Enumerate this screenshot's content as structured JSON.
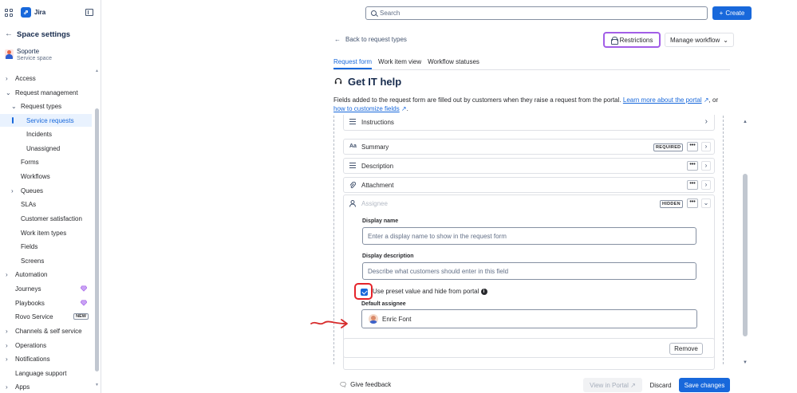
{
  "app": {
    "name": "Jira"
  },
  "sidebar": {
    "title": "Space settings",
    "space_name": "Soporte",
    "space_type": "Service space",
    "items": [
      {
        "label": "Access",
        "chevron": "›"
      },
      {
        "label": "Request management",
        "chevron": "⌄"
      },
      {
        "label": "Request types",
        "chevron": "⌄"
      },
      {
        "label": "Service requests",
        "active": true
      },
      {
        "label": "Incidents"
      },
      {
        "label": "Unassigned"
      },
      {
        "label": "Forms"
      },
      {
        "label": "Workflows"
      },
      {
        "label": "Queues",
        "chevron": "›"
      },
      {
        "label": "SLAs"
      },
      {
        "label": "Customer satisfaction"
      },
      {
        "label": "Work item types"
      },
      {
        "label": "Fields"
      },
      {
        "label": "Screens"
      },
      {
        "label": "Automation",
        "chevron": "›"
      },
      {
        "label": "Journeys",
        "icon": "premium-diamond-icon"
      },
      {
        "label": "Playbooks",
        "icon": "premium-diamond-icon"
      },
      {
        "label": "Rovo Service",
        "badge": "NEW"
      },
      {
        "label": "Channels & self service",
        "chevron": "›"
      },
      {
        "label": "Operations",
        "chevron": "›"
      },
      {
        "label": "Notifications",
        "chevron": "›"
      },
      {
        "label": "Language support"
      },
      {
        "label": "Apps",
        "chevron": "›"
      }
    ]
  },
  "topbar": {
    "search_placeholder": "Search",
    "create_label": "Create"
  },
  "header": {
    "back_label": "Back to request types",
    "restrictions_label": "Restrictions",
    "workflow_label": "Manage workflow"
  },
  "tabs": [
    "Request form",
    "Work item view",
    "Workflow statuses"
  ],
  "form": {
    "title": "Get IT help",
    "description_pre": "Fields added to the request form are filled out by customers when they raise a request from the portal.",
    "learn_more": "Learn more about the portal",
    "description_or": ", or",
    "customize_link": "how to customize fields",
    "fields": [
      {
        "label": "Instructions",
        "icon": "≡"
      },
      {
        "label": "Summary",
        "icon": "Aa",
        "badge": "REQUIRED"
      },
      {
        "label": "Description",
        "icon": "≡"
      },
      {
        "label": "Attachment",
        "icon": "⌀"
      }
    ],
    "assignee": {
      "label": "Assignee",
      "badge": "HIDDEN",
      "display_name_label": "Display name",
      "display_name_placeholder": "Enter a display name to show in the request form",
      "display_desc_label": "Display description",
      "display_desc_placeholder": "Describe what customers should enter in this field",
      "checkbox_label": "Use preset value and hide from portal",
      "checkbox_checked": true,
      "default_label": "Default assignee",
      "default_user": "Enric Font",
      "remove_label": "Remove"
    }
  },
  "footer": {
    "feedback_label": "Give feedback",
    "portal_label": "View in Portal",
    "discard_label": "Discard",
    "save_label": "Save changes"
  },
  "colors": {
    "primary": "#1868db",
    "highlight_purple": "#a25ee7",
    "annotation_red": "#e5242b"
  }
}
